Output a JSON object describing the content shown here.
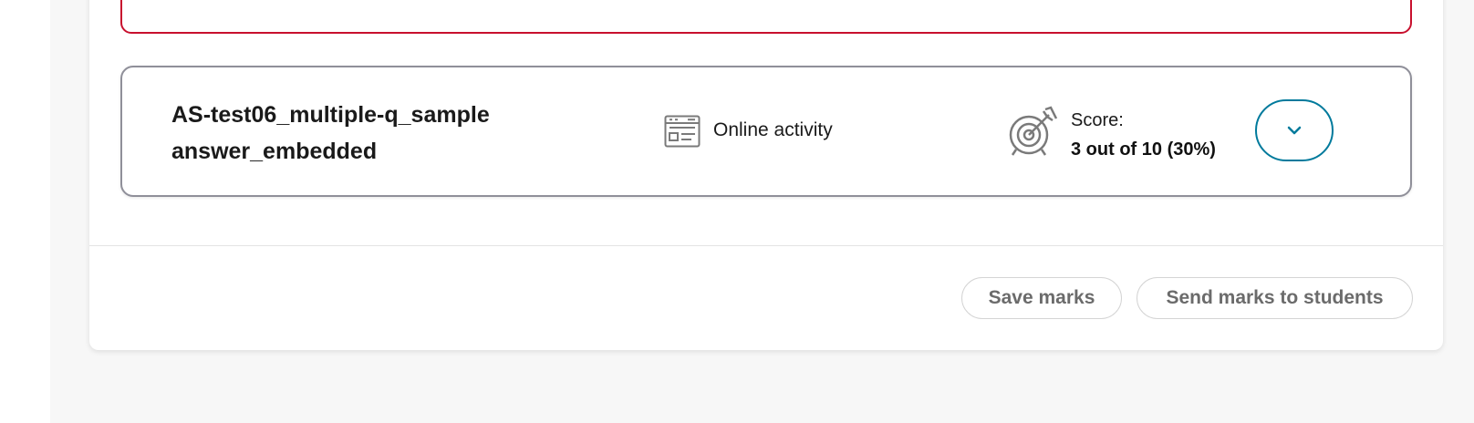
{
  "assignment": {
    "title": "AS-test06_multiple-q_sample answer_embedded",
    "activity_type": "Online activity",
    "score_label": "Score:",
    "score_value": "3 out of 10 (30%)",
    "expand_icon": "chevron-down-icon",
    "activity_icon": "online-activity-icon",
    "score_icon": "target-icon"
  },
  "footer": {
    "save_label": "Save marks",
    "send_label": "Send marks to students"
  },
  "colors": {
    "accent": "#007a9c",
    "error_border": "#c8102e",
    "card_border": "#8f8f99",
    "button_text": "#6b6b6b"
  }
}
